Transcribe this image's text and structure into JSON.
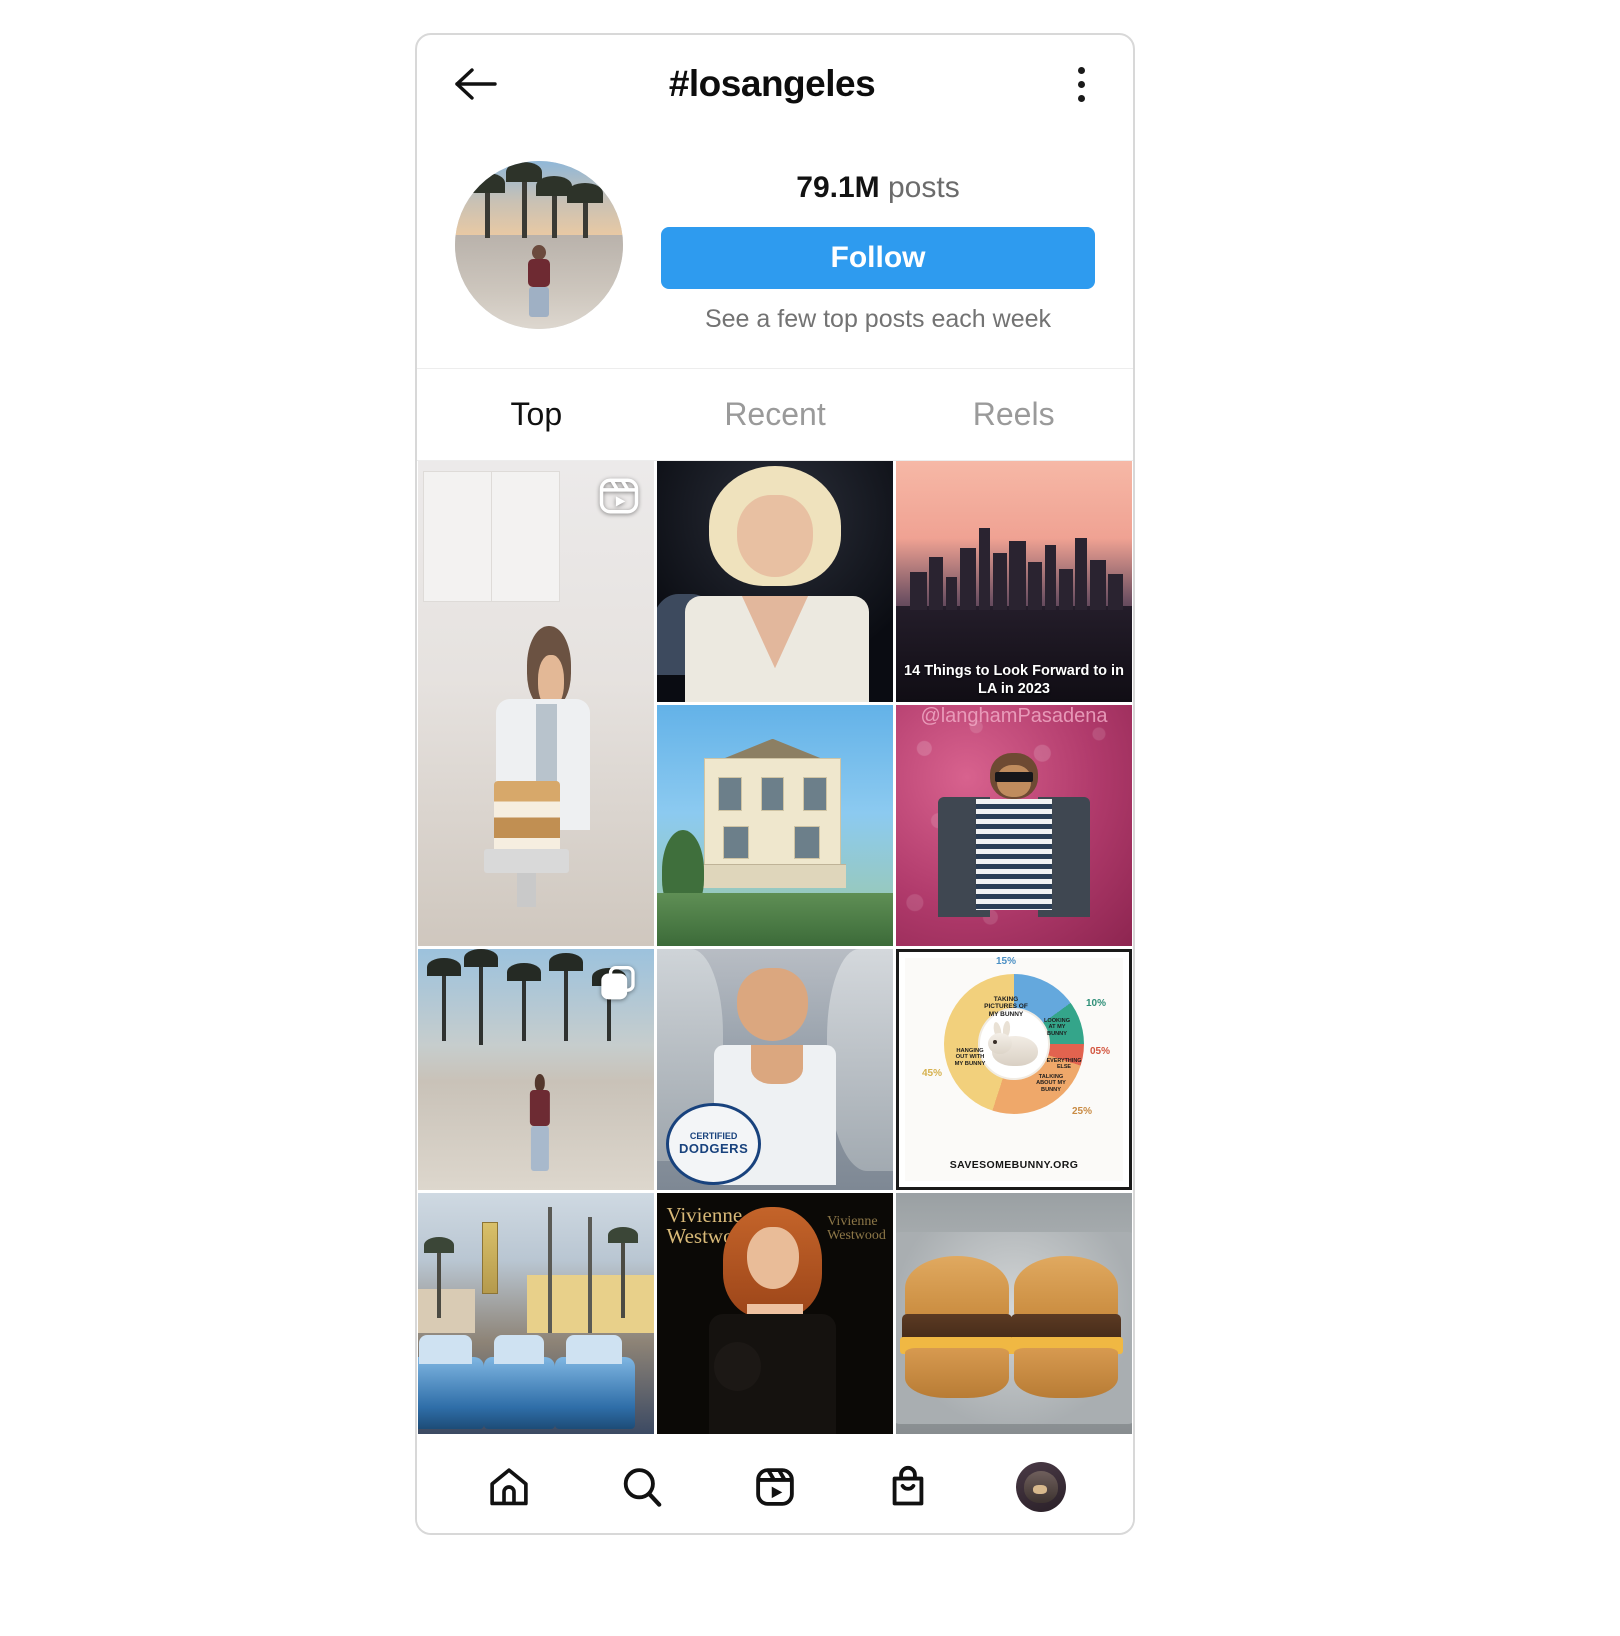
{
  "header": {
    "back_icon": "back-arrow-icon",
    "title": "#losangeles",
    "menu_icon": "kebab-menu-icon"
  },
  "hashtag_info": {
    "avatar_alt": "hashtag-cover-photo",
    "posts_count": "79.1M",
    "posts_label": "posts",
    "follow_label": "Follow",
    "follow_subtitle": "See a few top posts each week",
    "follow_color": "#2e9bef"
  },
  "tabs": [
    {
      "label": "Top",
      "active": true
    },
    {
      "label": "Recent",
      "active": false
    },
    {
      "label": "Reels",
      "active": false
    }
  ],
  "grid": {
    "tiles": [
      {
        "name": "post-baking-reel",
        "overlay": "reels-icon",
        "caption": ""
      },
      {
        "name": "post-blonde-portrait",
        "overlay": "",
        "caption": ""
      },
      {
        "name": "post-la-skyline",
        "overlay": "",
        "caption": "14 Things to Look Forward to in LA in 2023"
      },
      {
        "name": "post-victorian-house",
        "overlay": "",
        "caption": ""
      },
      {
        "name": "post-pink-flower-wall",
        "overlay": "",
        "caption": "@langhamPasadena"
      },
      {
        "name": "post-venice-beach",
        "overlay": "carousel-icon",
        "caption": ""
      },
      {
        "name": "post-dodgers-fan",
        "overlay": "",
        "caption": ""
      },
      {
        "name": "post-bunny-chart",
        "overlay": "",
        "caption": ""
      },
      {
        "name": "post-lowrider-street",
        "overlay": "",
        "caption": ""
      },
      {
        "name": "post-vivienne-westwood",
        "overlay": "",
        "caption": ""
      },
      {
        "name": "post-burgers",
        "overlay": "",
        "caption": ""
      }
    ],
    "dodgers_badge": {
      "line1": "CERTIFIED",
      "line2": "DODGERS"
    },
    "vivienne_wordmark": "Vivienne\nWestwood",
    "vivienne_wordmark2": "Vivienne\nWestwood"
  },
  "chart_data": {
    "type": "pie",
    "title": "",
    "source": "SAVESOMEBUNNY.ORG",
    "categories": [
      "TAKING PICTURES OF MY BUNNY",
      "LOOKING AT MY BUNNY",
      "EVERYTHING ELSE",
      "TALKING ABOUT MY BUNNY",
      "HANGING OUT WITH MY BUNNY"
    ],
    "values": [
      15,
      10,
      5,
      25,
      45
    ],
    "labels": [
      "15%",
      "10%",
      "05%",
      "25%",
      "45%"
    ],
    "colors": [
      "#64a8dd",
      "#34a58a",
      "#e2634f",
      "#efa86a",
      "#f2d07c"
    ],
    "legend": "inside-slices",
    "center_image": "bunny-photo"
  },
  "bottom_nav": [
    {
      "name": "home-icon",
      "label": "Home"
    },
    {
      "name": "search-icon",
      "label": "Search"
    },
    {
      "name": "reels-icon",
      "label": "Reels"
    },
    {
      "name": "shop-icon",
      "label": "Shop"
    },
    {
      "name": "profile-avatar",
      "label": "Profile"
    }
  ]
}
